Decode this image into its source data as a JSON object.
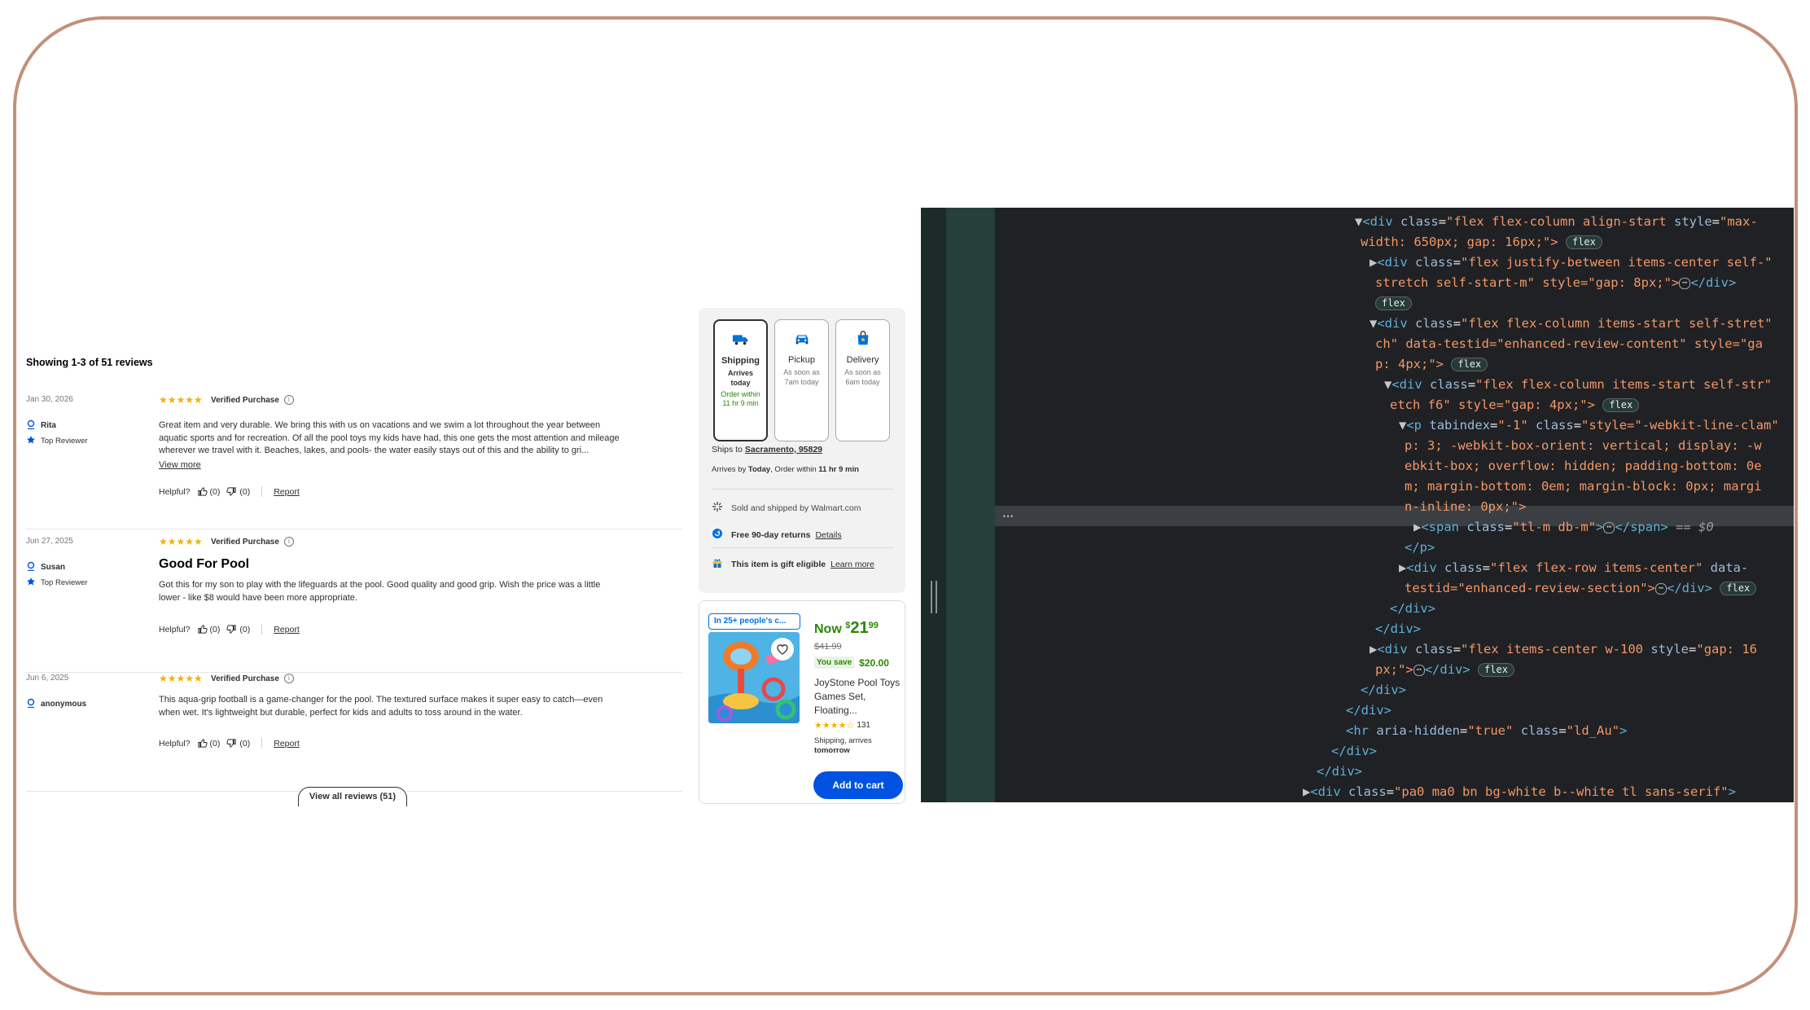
{
  "reviews": {
    "showing": "Showing 1-3 of 51 reviews",
    "items": [
      {
        "date": "Jan 30, 2026",
        "user": "Rita",
        "badge": "Top Reviewer",
        "stars": "★★★★★",
        "verified": "Verified Purchase",
        "title": "",
        "text": "Great item and very durable. We bring this with us on vacations and we swim a lot throughout the year between aquatic sports and for recreation. Of all the pool toys my kids have had, this one gets the most attention and mileage wherever we travel with it. Beaches, lakes, and pools- the water easily stays out of this and the ability to gri...",
        "view_more": "View more",
        "helpful": "Helpful?",
        "up": "(0)",
        "down": "(0)",
        "report": "Report"
      },
      {
        "date": "Jun 27, 2025",
        "user": "Susan",
        "badge": "Top Reviewer",
        "stars": "★★★★★",
        "verified": "Verified Purchase",
        "title": "Good For Pool",
        "text": "Got this for my son to play with the lifeguards at the pool. Good quality and good grip. Wish the price was a little lower - like $8 would have been more appropriate.",
        "helpful": "Helpful?",
        "up": "(0)",
        "down": "(0)",
        "report": "Report"
      },
      {
        "date": "Jun 6, 2025",
        "user": "anonymous",
        "stars": "★★★★★",
        "verified": "Verified Purchase",
        "title": "",
        "text": "This aqua-grip football is a game-changer for the pool. The textured surface makes it super easy to catch—even when wet. It's lightweight but durable, perfect for kids and adults to toss around in the water.",
        "helpful": "Helpful?",
        "up": "(0)",
        "down": "(0)",
        "report": "Report"
      }
    ],
    "view_all": "View all reviews (51)"
  },
  "fulfillment": {
    "options": [
      {
        "label": "Shipping",
        "sub": "Arrives today",
        "green": "Order within 11 hr 9 min",
        "icon": "truck-icon"
      },
      {
        "label": "Pickup",
        "sub": "As soon as 7am today",
        "icon": "car-icon"
      },
      {
        "label": "Delivery",
        "sub": "As soon as 6am today",
        "icon": "delivery-bag-icon"
      }
    ],
    "ships_to_label": "Ships to",
    "ships_to_value": "Sacramento, 95829",
    "arrives_prefix": "Arrives by",
    "arrives_day": "Today",
    "order_within_prefix": ", Order within",
    "order_within": "11 hr 9 min",
    "sold_by": "Sold and shipped by Walmart.com",
    "returns": "Free 90-day returns",
    "returns_link": "Details",
    "gift": "This item is gift eligible",
    "gift_link": "Learn more"
  },
  "ad": {
    "tag": "In 25+ people's c...",
    "now_label": "Now",
    "currency": "$",
    "price_whole": "21",
    "price_cents": "99",
    "was": "$41.99",
    "you_save_label": "You save",
    "you_save": "$20.00",
    "name": "JoyStone Pool Toys Games Set, Floating...",
    "stars": "★★★★☆",
    "rating_count": "131",
    "ship_line1": "Shipping, arrives",
    "ship_line2": "tomorrow",
    "button": "Add to cart",
    "colors": {
      "primary": "#0053e2",
      "green": "#2a8703"
    }
  },
  "devtools": {
    "lines": [
      {
        "tag": "div",
        "attrs": [
          [
            "class",
            "flex flex-column align-start"
          ],
          [
            "style",
            "max-"
          ]
        ],
        "cont": "width: 650px; gap: 16px;\">",
        "badge": "flex"
      },
      {
        "tag": "div",
        "attrs": [
          [
            "class",
            "flex justify-between items-center self-"
          ]
        ],
        "cont": "stretch self-start-m\" style=\"gap: 8px;\">",
        "ellipsis": "⋯",
        "close": "</div>",
        "badge": "flex"
      },
      {
        "tag": "div",
        "attrs": [
          [
            "class",
            "flex flex-column items-start self-stret"
          ]
        ],
        "cont": "ch\" data-testid=\"enhanced-review-content\" style=\"ga",
        "cont2": "p: 4px;\">",
        "badge": "flex"
      },
      {
        "tag": "div",
        "attrs": [
          [
            "class",
            "flex flex-column items-start self-str"
          ]
        ],
        "cont": "etch f6\" style=\"gap: 4px;\">",
        "badge": "flex"
      },
      {
        "tag": "p",
        "attrs": [
          [
            "tabindex",
            "-1"
          ],
          [
            "class",
            "style=\"-webkit-line-clam"
          ]
        ],
        "cont": "p: 3; -webkit-box-orient: vertical; display: -w",
        "cont2": "ebkit-box; overflow: hidden; padding-bottom: 0e",
        "cont3": "m; margin-bottom: 0em; margin-block: 0px; margi",
        "cont4": "n-inline: 0px;\">"
      },
      {
        "tag": "span",
        "attrs": [
          [
            "class",
            "tl-m db-m"
          ]
        ],
        "ellipsis": "⋯",
        "close": "</span>",
        "selected_marker": "== $0"
      },
      {
        "close": "</p>"
      },
      {
        "tag": "div",
        "attrs": [
          [
            "class",
            "flex flex-row items-center"
          ],
          [
            "data-",
            ""
          ]
        ],
        "cont": "testid=\"enhanced-review-section\">",
        "ellipsis": "⋯",
        "close": "</div>",
        "badge": "flex"
      },
      {
        "close": "</div>"
      },
      {
        "close": "</div>"
      },
      {
        "tag": "div",
        "attrs": [
          [
            "class",
            "flex items-center w-100"
          ],
          [
            "style",
            "gap: 16"
          ]
        ],
        "cont": "px;\">",
        "ellipsis": "⋯",
        "close": "</div>",
        "badge": "flex"
      },
      {
        "close": "</div>"
      },
      {
        "close": "</div>"
      },
      {
        "tag": "hr",
        "attrs": [
          [
            "aria-hidden",
            "true"
          ],
          [
            "class",
            "ld_Au"
          ]
        ]
      },
      {
        "close": "</div>"
      },
      {
        "close": "</div>"
      },
      {
        "tag": "div",
        "attrs": [
          [
            "class",
            "pa0 ma0 bn bg-white b--white tl sans-serif"
          ]
        ]
      }
    ],
    "gutter_dots": "⋯"
  }
}
